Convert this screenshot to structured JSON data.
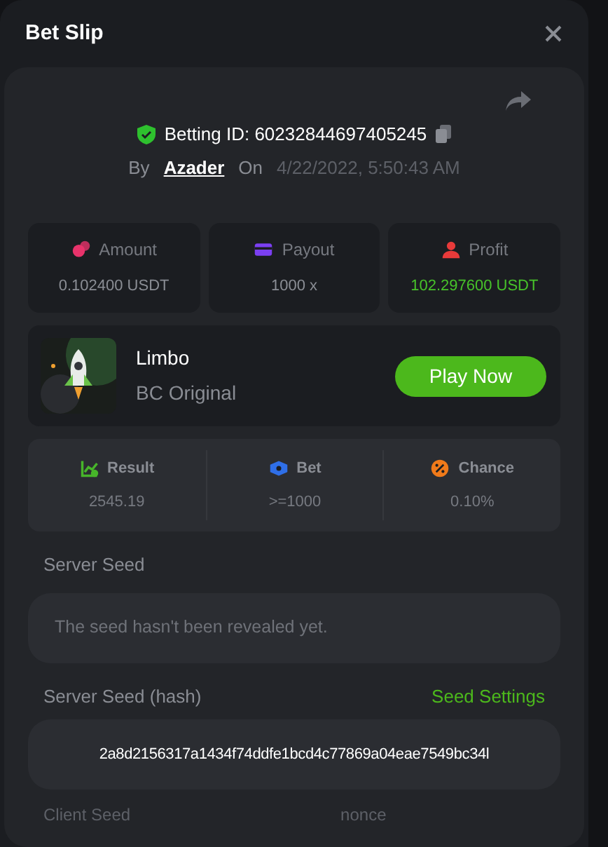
{
  "window": {
    "title": "Bet Slip"
  },
  "bet": {
    "id_label": "Betting ID: 60232844697405245",
    "by_label": "By",
    "user": "Azader",
    "on_label": "On",
    "date": "4/22/2022, 5:50:43 AM"
  },
  "stats": [
    {
      "kind": "amount",
      "label": "Amount",
      "value": "0.102400 USDT",
      "color": "#e8336b",
      "positive": false
    },
    {
      "kind": "payout",
      "label": "Payout",
      "value": "1000 x",
      "color": "#7b3ff2",
      "positive": false
    },
    {
      "kind": "profit",
      "label": "Profit",
      "value": "102.297600 USDT",
      "color": "#e83a3a",
      "positive": true
    }
  ],
  "game": {
    "name": "Limbo",
    "provider": "BC Original",
    "button": "Play Now"
  },
  "results": [
    {
      "kind": "result",
      "label": "Result",
      "value": "2545.19",
      "color": "#47b52a"
    },
    {
      "kind": "bet",
      "label": "Bet",
      "value": ">=1000",
      "color": "#2f6fe8"
    },
    {
      "kind": "chance",
      "label": "Chance",
      "value": "0.10%",
      "color": "#f07a1a"
    }
  ],
  "server_seed": {
    "label": "Server Seed",
    "value": "The seed hasn't been revealed yet."
  },
  "server_seed_hash": {
    "label": "Server Seed (hash)",
    "link": "Seed Settings",
    "value": "2a8d2156317a1434f74ddfe1bcd4c77869a04eae7549bc34l"
  },
  "client_seed": {
    "label": "Client Seed",
    "nonce_label": "nonce"
  }
}
